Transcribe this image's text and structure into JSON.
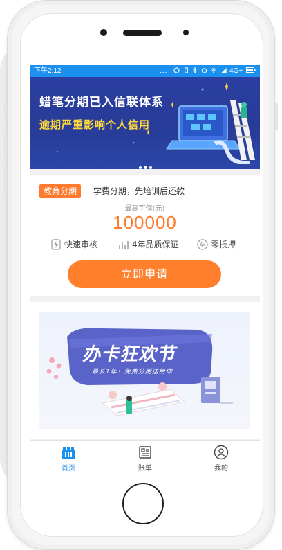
{
  "status_bar": {
    "time": "下午2:12",
    "dots": "...",
    "network": "4G+"
  },
  "banner": {
    "line1": "蜡笔分期已入信联体系",
    "line2": "逾期严重影响个人信用"
  },
  "loan_card": {
    "tag": "教育分期",
    "tagline": "学费分期，先培训后还款",
    "quota_label": "最高可借(元)",
    "quota_value": "100000",
    "features": [
      {
        "icon": "lightning-icon",
        "label": "快速审核"
      },
      {
        "icon": "chart-rise-icon",
        "label": "4年品质保证"
      },
      {
        "icon": "no-deposit-icon",
        "label": "零抵押"
      }
    ],
    "apply_label": "立即申请"
  },
  "promo": {
    "title": "办卡狂欢节",
    "subtitle": "最长1年！免费分期送给你"
  },
  "tabbar": {
    "tabs": [
      {
        "label": "首页",
        "icon": "home-icon",
        "active": true
      },
      {
        "label": "账单",
        "icon": "bill-icon",
        "active": false
      },
      {
        "label": "我的",
        "icon": "user-icon",
        "active": false
      }
    ]
  },
  "colors": {
    "status_bar": "#1b90ee",
    "accent_orange": "#ff7a2e",
    "banner_bg": "#2b3fa0",
    "banner_highlight": "#ffd83a",
    "tab_active": "#1b90ee"
  }
}
